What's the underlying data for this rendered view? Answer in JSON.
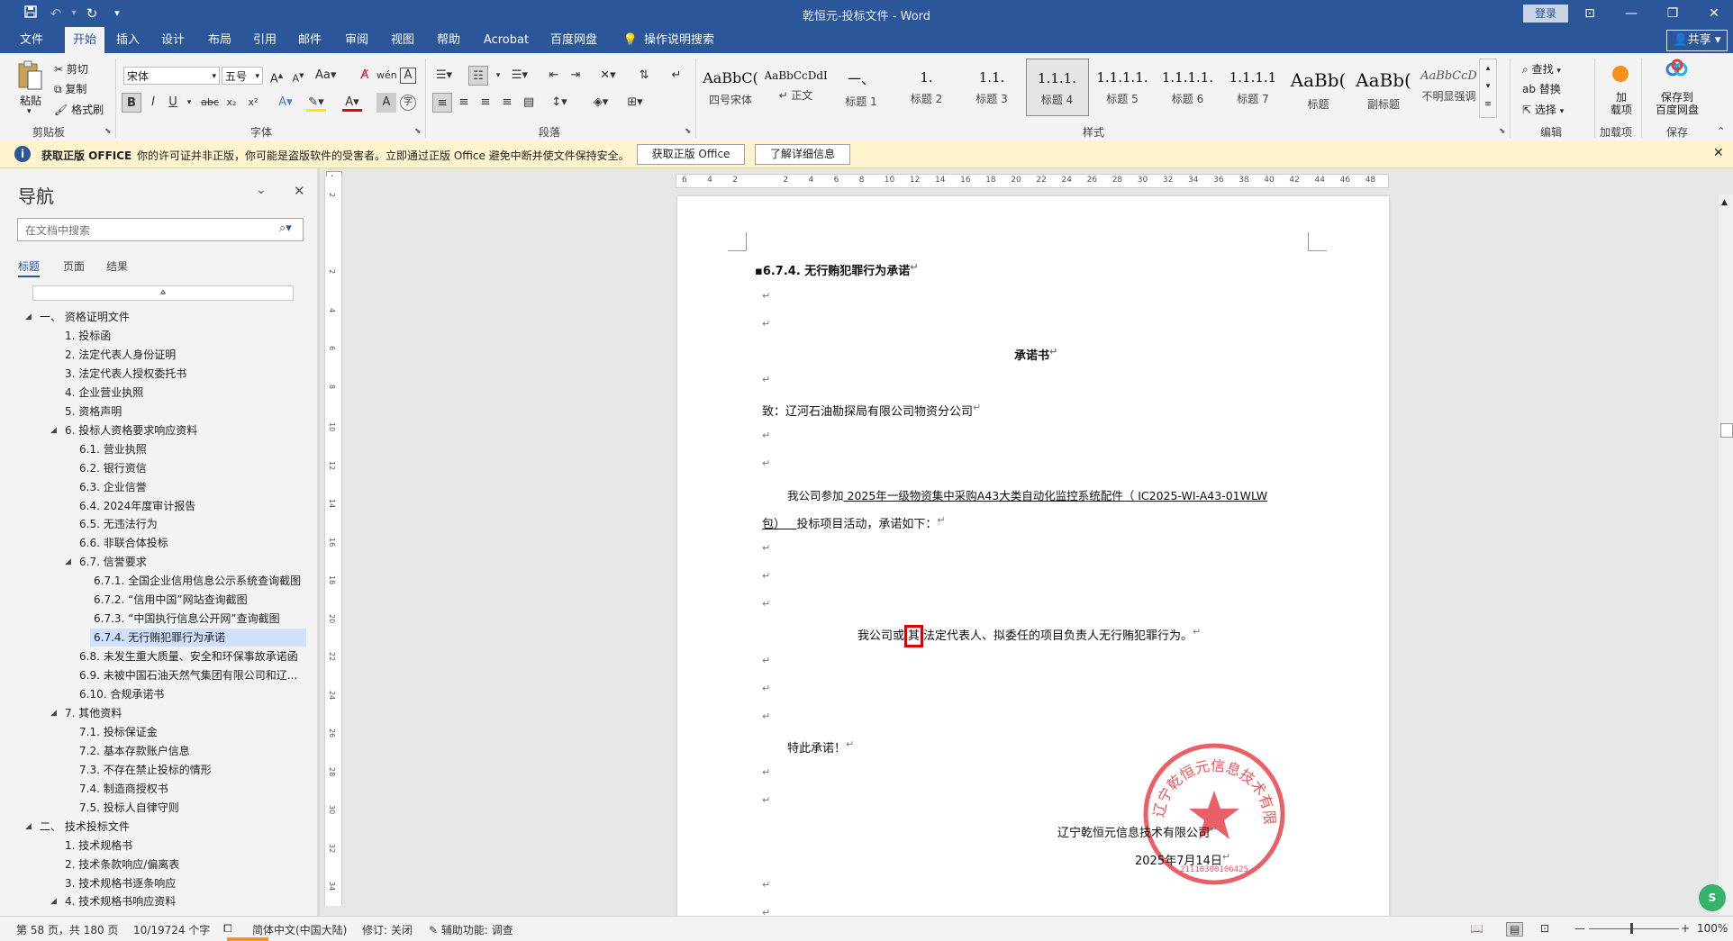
{
  "app": {
    "title": "乾恒元-投标文件 - Word",
    "login": "登录"
  },
  "window_controls": {
    "ribbon_opts": "⊡",
    "minimize": "—",
    "restore": "❐",
    "close": "✕"
  },
  "menu": {
    "tabs": [
      "文件",
      "开始",
      "插入",
      "设计",
      "布局",
      "引用",
      "邮件",
      "审阅",
      "视图",
      "帮助",
      "Acrobat",
      "百度网盘"
    ],
    "active_tab": "开始",
    "tell_me": "操作说明搜索",
    "share": "共享"
  },
  "ribbon": {
    "clipboard": {
      "label": "剪贴板",
      "paste": "粘贴",
      "cut": "剪切",
      "copy": "复制",
      "format_painter": "格式刷"
    },
    "font": {
      "label": "字体",
      "font_name": "宋体",
      "font_size": "五号"
    },
    "paragraph": {
      "label": "段落"
    },
    "styles": {
      "label": "样式",
      "items": [
        {
          "preview": "AaBbC(",
          "name": "四号宋体"
        },
        {
          "preview": "AaBbCcDdI",
          "name": "↵ 正文"
        },
        {
          "preview": "一、",
          "name": "标题 1"
        },
        {
          "preview": "1.",
          "name": "标题 2"
        },
        {
          "preview": "1.1.",
          "name": "标题 3"
        },
        {
          "preview": "1.1.1.",
          "name": "标题 4"
        },
        {
          "preview": "1.1.1.1.",
          "name": "标题 5"
        },
        {
          "preview": "1.1.1.1.",
          "name": "标题 6"
        },
        {
          "preview": "1.1.1.1",
          "name": "标题 7"
        },
        {
          "preview": "AaBb(",
          "name": "标题"
        },
        {
          "preview": "AaBb(",
          "name": "副标题"
        },
        {
          "preview": "AaBbCcD",
          "name": "不明显强调"
        }
      ],
      "selected": "标题 4"
    },
    "editing": {
      "label": "编辑",
      "find": "查找",
      "replace": "替换",
      "select": "选择"
    },
    "addins": {
      "label": "加载项",
      "btn": "加\n载项"
    },
    "save": {
      "label": "保存",
      "btn": "保存到\n百度网盘"
    }
  },
  "infobar": {
    "title": "获取正版 OFFICE",
    "message": "你的许可证并非正版，你可能是盗版软件的受害者。立即通过正版 Office 避免中断并使文件保持安全。",
    "btn_get": "获取正版 Office",
    "btn_more": "了解详细信息"
  },
  "nav": {
    "title": "导航",
    "search_placeholder": "在文档中搜索",
    "tabs": [
      "标题",
      "页面",
      "结果"
    ],
    "items": [
      {
        "level": 0,
        "text": "一、 资格证明文件",
        "expand": "open"
      },
      {
        "level": 1,
        "text": "1. 投标函"
      },
      {
        "level": 1,
        "text": "2. 法定代表人身份证明"
      },
      {
        "level": 1,
        "text": "3. 法定代表人授权委托书"
      },
      {
        "level": 1,
        "text": "4. 企业营业执照"
      },
      {
        "level": 1,
        "text": "5. 资格声明"
      },
      {
        "level": 1,
        "text": "6. 投标人资格要求响应资料",
        "expand": "open"
      },
      {
        "level": 2,
        "text": "6.1. 营业执照"
      },
      {
        "level": 2,
        "text": "6.2. 银行资信"
      },
      {
        "level": 2,
        "text": "6.3. 企业信誉"
      },
      {
        "level": 2,
        "text": "6.4. 2024年度审计报告"
      },
      {
        "level": 2,
        "text": "6.5. 无违法行为"
      },
      {
        "level": 2,
        "text": "6.6. 非联合体投标"
      },
      {
        "level": 2,
        "text": "6.7. 信誉要求",
        "expand": "open"
      },
      {
        "level": 3,
        "text": "6.7.1. 全国企业信用信息公示系统查询截图"
      },
      {
        "level": 3,
        "text": "6.7.2. “信用中国”网站查询截图"
      },
      {
        "level": 3,
        "text": "6.7.3. “中国执行信息公开网”查询截图"
      },
      {
        "level": 3,
        "text": "6.7.4. 无行贿犯罪行为承诺",
        "selected": true
      },
      {
        "level": 2,
        "text": "6.8. 未发生重大质量、安全和环保事故承诺函"
      },
      {
        "level": 2,
        "text": "6.9. 未被中国石油天然气集团有限公司和辽..."
      },
      {
        "level": 2,
        "text": "6.10. 合规承诺书"
      },
      {
        "level": 1,
        "text": "7. 其他资料",
        "expand": "open"
      },
      {
        "level": 2,
        "text": "7.1. 投标保证金"
      },
      {
        "level": 2,
        "text": "7.2. 基本存款账户信息"
      },
      {
        "level": 2,
        "text": "7.3. 不存在禁止投标的情形"
      },
      {
        "level": 2,
        "text": "7.4. 制造商授权书"
      },
      {
        "level": 2,
        "text": "7.5. 投标人自律守则"
      },
      {
        "level": 0,
        "text": "二、 技术投标文件",
        "expand": "open"
      },
      {
        "level": 1,
        "text": "1. 技术规格书"
      },
      {
        "level": 1,
        "text": "2. 技术条款响应/偏离表"
      },
      {
        "level": 1,
        "text": "3. 技术规格书逐条响应"
      },
      {
        "level": 1,
        "text": "4. 技术规格书响应资料",
        "expand": "open"
      }
    ]
  },
  "ruler": {
    "h_ticks": [
      "6",
      "4",
      "2",
      "",
      "2",
      "4",
      "6",
      "8",
      "10",
      "12",
      "14",
      "16",
      "18",
      "20",
      "22",
      "24",
      "26",
      "28",
      "30",
      "32",
      "34",
      "36",
      "38",
      "40",
      "42",
      "44",
      "46",
      "48"
    ],
    "v_ticks": [
      "2",
      "",
      "2",
      "4",
      "6",
      "8",
      "10",
      "12",
      "14",
      "16",
      "18",
      "20",
      "22",
      "24",
      "26",
      "28",
      "30",
      "32",
      "34"
    ]
  },
  "document": {
    "heading": "6.7.4. 无行贿犯罪行为承诺",
    "title": "承诺书",
    "to": "致：辽河石油勘探局有限公司物资分公司",
    "para1_a": "我公司参加",
    "para1_u": "  2025年一级物资集中采购A43大类自动化监控系统配件（ IC2025-WI-A43-01WLW",
    "para1_b_u": "包）   ",
    "para1_c": "投标项目活动，承诺如下：",
    "pledge_a": "我公司或",
    "pledge_hl": "其",
    "pledge_b": "法定代表人、拟委任的项目负责人无行贿犯罪行为。",
    "closing": "特此承诺！",
    "company": "辽宁乾恒元信息技术有限公司",
    "date": "2025年7月14日",
    "para_mark": "↵",
    "seal_text": "辽宁乾恒元信息技术有限公司",
    "seal_code": "21110300106425",
    "highlight_color": "#e00000",
    "seal_color": "#e8434b"
  },
  "status": {
    "page": "第 58 页，共 180 页",
    "words": "10/19724 个字",
    "language": "简体中文(中国大陆)",
    "track": "修订: 关闭",
    "accessibility": "辅助功能: 调查",
    "zoom": "100%"
  },
  "colors": {
    "brand": "#2b579a",
    "info": "#fff4ce"
  }
}
